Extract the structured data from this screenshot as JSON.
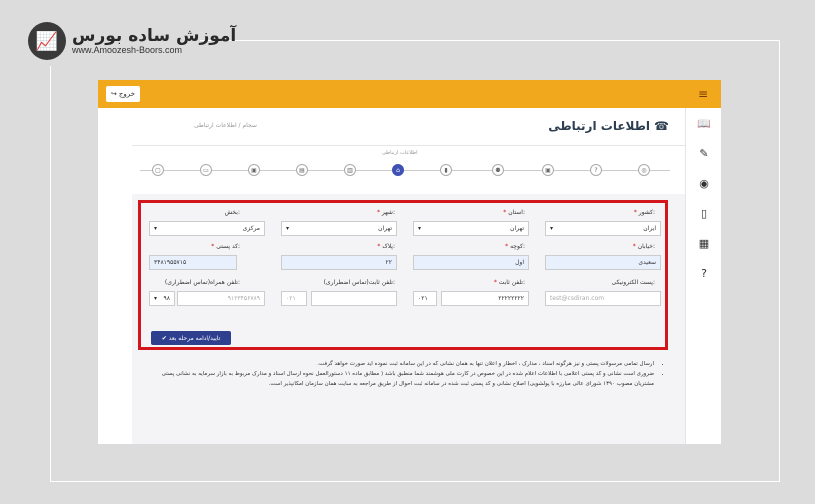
{
  "logo": {
    "fa": "آموزش ساده بورس",
    "en": "www.Amoozesh-Boors.com"
  },
  "toolbar": {
    "exit_label": "خروج"
  },
  "page": {
    "title": "اطلاعات ارتباطی",
    "breadcrumb": "سجام / اطلاعات ارتباطی"
  },
  "steps": {
    "label": "اطلاعات ارتباطی"
  },
  "form": {
    "country_label": "کشور",
    "country_value": "ایران",
    "province_label": "استان",
    "province_value": "تهران",
    "city_label": "شهر",
    "city_value": "تهران",
    "district_label": "بخش",
    "district_value": "مرکزی",
    "street_label": "خیابان",
    "street_value": "سعیدی",
    "alley_label": "کوچه",
    "alley_value": "اول",
    "plaque_label": "پلاک",
    "plaque_value": "۲۲",
    "postal_label": "کد پستی",
    "postal_value": "۳۴۸۱۹۵۵۷۱۵",
    "email_label": "پست الکترونیکی",
    "email_placeholder": "test@csdiran.com",
    "phone_label": "تلفن ثابت",
    "phone_value": "۲۲۲۲۲۲۲۲",
    "phone_code": "۰۲۱",
    "emergency_phone_label": "تلفن ثابت(تماس اضطراری)",
    "emergency_phone_code": "۰۲۱",
    "mobile_label": "تلفن همراه(تماس اضطراری)",
    "mobile_value": "۹۱۲۳۴۵۶۷۸۹",
    "mobile_code": "۹۸",
    "submit_label": "تایید/ادامه مرحله بعد"
  },
  "notes": [
    "ارسال تمامی مرسولات پستی و نیز هرگونه اسناد ، مدارک ، اخطار و اعلان تنها به همان نشانی که در این سامانه ثبت نموده اید صورت خواهد گرفت.",
    "ضروری است نشانی و کد پستی اعلامی با اطلاعات اعلام شده در این خصوص در کارت ملی هوشمند شما منطبق باشد ( مطابق ماده ۱۱ دستورالعمل نحوه ارسال اسناد و مدارک مربوط به بازار سرمایه به نشانی پستی مشتریان مصوب ۱۳۹۰ شورای عالی مبارزه با پولشویی) اصلاح نشانی و کد پستی ثبت شده در سامانه ثبت احوال از طریق مراجعه به سایت همان سازمان امکانپذیر است."
  ],
  "colors": {
    "accent": "#f2a81c",
    "highlight": "#d3151c",
    "primary": "#2e3f8f"
  }
}
